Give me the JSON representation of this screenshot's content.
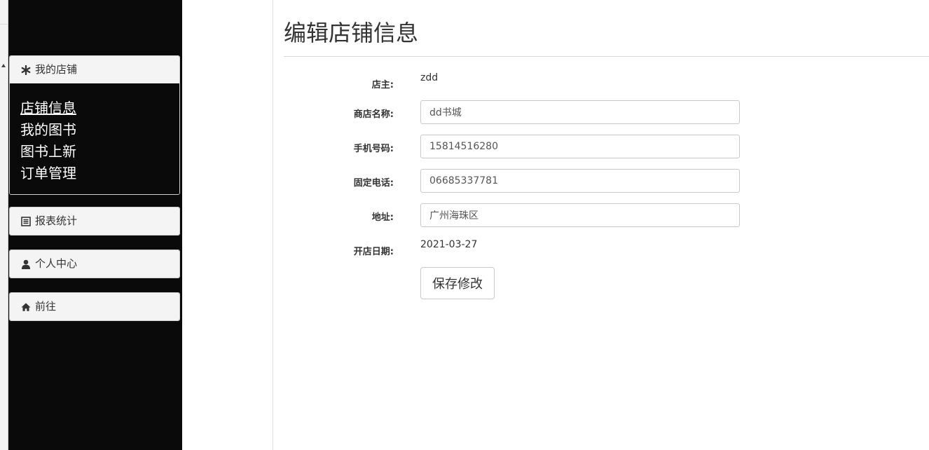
{
  "sidebar": {
    "shop": {
      "title": "我的店铺",
      "icon": "asterisk-icon",
      "items": [
        "店铺信息",
        "我的图书",
        "图书上新",
        "订单管理"
      ]
    },
    "report": {
      "title": "报表统计",
      "icon": "list-icon"
    },
    "personal": {
      "title": "个人中心",
      "icon": "user-icon"
    },
    "goto": {
      "title": "前往",
      "icon": "home-icon"
    }
  },
  "main": {
    "title": "编辑店铺信息",
    "fields": {
      "owner": {
        "label": "店主:",
        "value": "zdd"
      },
      "shop_name": {
        "label": "商店名称:",
        "value": "dd书城"
      },
      "mobile": {
        "label": "手机号码:",
        "value": "15814516280"
      },
      "landline": {
        "label": "固定电话:",
        "value": "06685337781"
      },
      "address": {
        "label": "地址:",
        "value": "广州海珠区"
      },
      "open_date": {
        "label": "开店日期:",
        "value": "2021-03-27"
      }
    },
    "save_label": "保存修改"
  }
}
